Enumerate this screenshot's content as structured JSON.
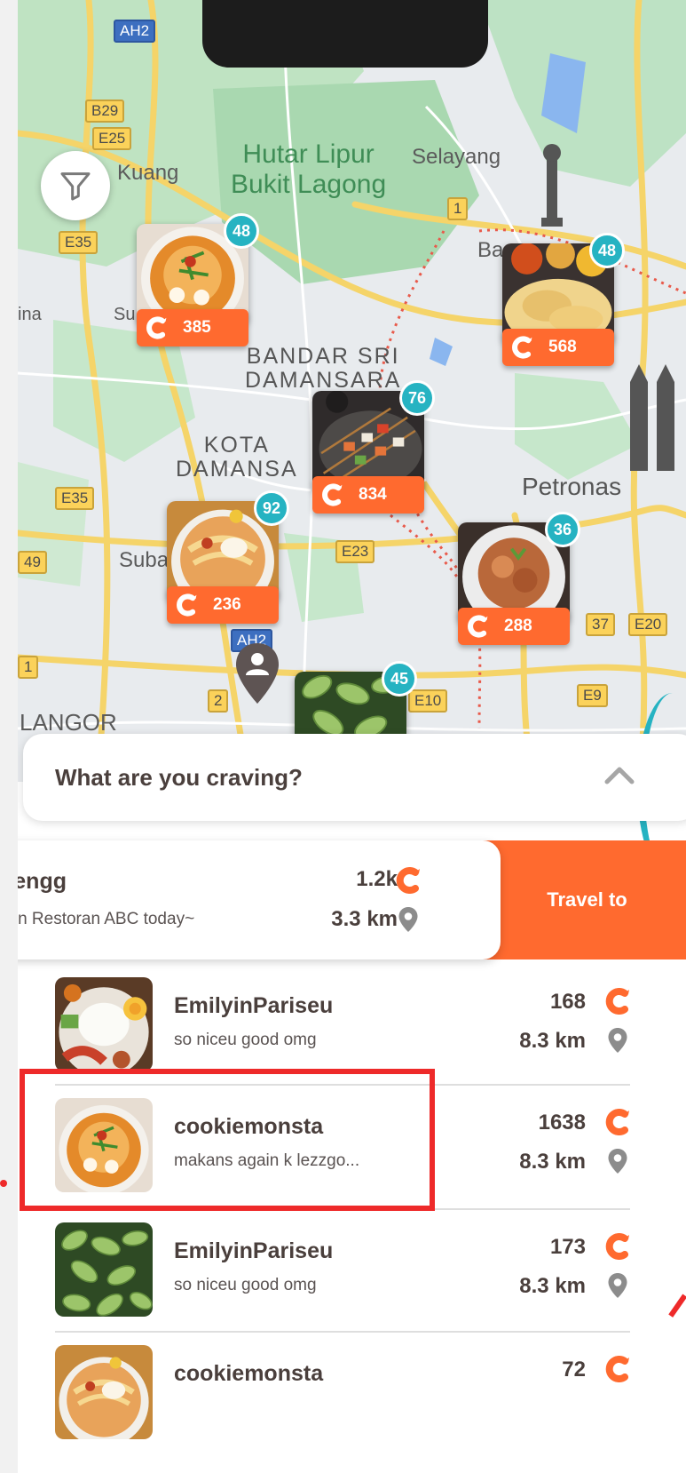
{
  "colors": {
    "accent": "#ff6a2f",
    "teal": "#26b3c2",
    "highlight": "#ee2a2a",
    "text_dark": "#4a3f3c"
  },
  "map": {
    "labels": {
      "park": "Hutar Lipur\nBukit Lagong",
      "selayang": "Selayang",
      "kuang": "Kuang",
      "bandar": "BANDAR SRI\nDAMANSARA",
      "kota": "KOTA\nDAMANSA",
      "petronas": "Petronas",
      "suba": "Suba",
      "langor": "LANGOR",
      "ina": "ina",
      "su": "Su",
      "ba": "Ba"
    },
    "shields": [
      "AH2",
      "B29",
      "E25",
      "E35",
      "1",
      "E35",
      "49",
      "E23",
      "AH2",
      "2",
      "E10",
      "37",
      "E20",
      "E9",
      "1"
    ],
    "markers": [
      {
        "count": "385",
        "badge": "48",
        "food": "curry-laksa"
      },
      {
        "count": "568",
        "badge": "48",
        "food": "roti-canai"
      },
      {
        "count": "834",
        "badge": "76",
        "food": "satay-skewers"
      },
      {
        "count": "236",
        "badge": "92",
        "food": "curry-mee"
      },
      {
        "count": "288",
        "badge": "36",
        "food": "fried-noodles"
      },
      {
        "count": "",
        "badge": "45",
        "food": "edamame"
      }
    ]
  },
  "craving": {
    "title": "What are you craving?"
  },
  "featured": {
    "name": "hengg",
    "message": "e in Restoran ABC today~",
    "points": "1.2k",
    "distance": "3.3 km",
    "travel_label": "Travel to"
  },
  "list": [
    {
      "name": "EmilyinPariseu",
      "message": "so niceu good omg",
      "points": "168",
      "distance": "8.3 km",
      "food": "nasi-lemak"
    },
    {
      "name": "cookiemonsta",
      "message": "makans again k lezzgo...",
      "points": "1638",
      "distance": "8.3 km",
      "food": "curry-laksa"
    },
    {
      "name": "EmilyinPariseu",
      "message": "so niceu good omg",
      "points": "173",
      "distance": "8.3 km",
      "food": "edamame"
    },
    {
      "name": "cookiemonsta",
      "message": "",
      "points": "72",
      "distance": "",
      "food": "curry-mee"
    }
  ]
}
